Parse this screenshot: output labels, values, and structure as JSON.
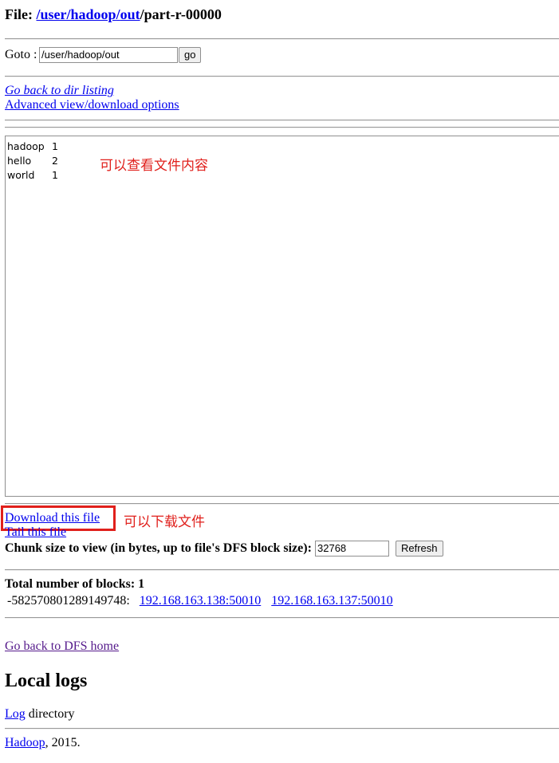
{
  "header": {
    "file_prefix": "File: ",
    "path_root": "/",
    "seg_user": "user",
    "seg_hadoop": "hadoop",
    "seg_out": "out",
    "sep": "/",
    "filename": "part-r-00000"
  },
  "goto": {
    "label": "Goto : ",
    "value": "/user/hadoop/out",
    "button": "go"
  },
  "links": {
    "back_dir": "Go back to dir listing",
    "advanced": "Advanced view/download options",
    "download": "Download this file",
    "tail": "Tail this file",
    "dfs_home": "Go back to DFS home"
  },
  "file_content": [
    {
      "word": "hadoop",
      "count": "1"
    },
    {
      "word": "hello",
      "count": "2"
    },
    {
      "word": "world",
      "count": "1"
    }
  ],
  "annotations": {
    "view_content": "可以查看文件内容",
    "download": "可以下载文件",
    "color": "#e0201c"
  },
  "chunk": {
    "label": "Chunk size to view (in bytes, up to file's DFS block size):",
    "value": "32768",
    "button": "Refresh"
  },
  "blocks": {
    "label": "Total number of blocks: 1",
    "block_id": "-582570801289149748:",
    "nodes": [
      "192.168.163.138:50010",
      "192.168.163.137:50010"
    ]
  },
  "logs": {
    "heading": "Local logs",
    "log_link": "Log",
    "log_suffix": " directory"
  },
  "footer": {
    "link": "Hadoop",
    "suffix": ", 2015."
  }
}
